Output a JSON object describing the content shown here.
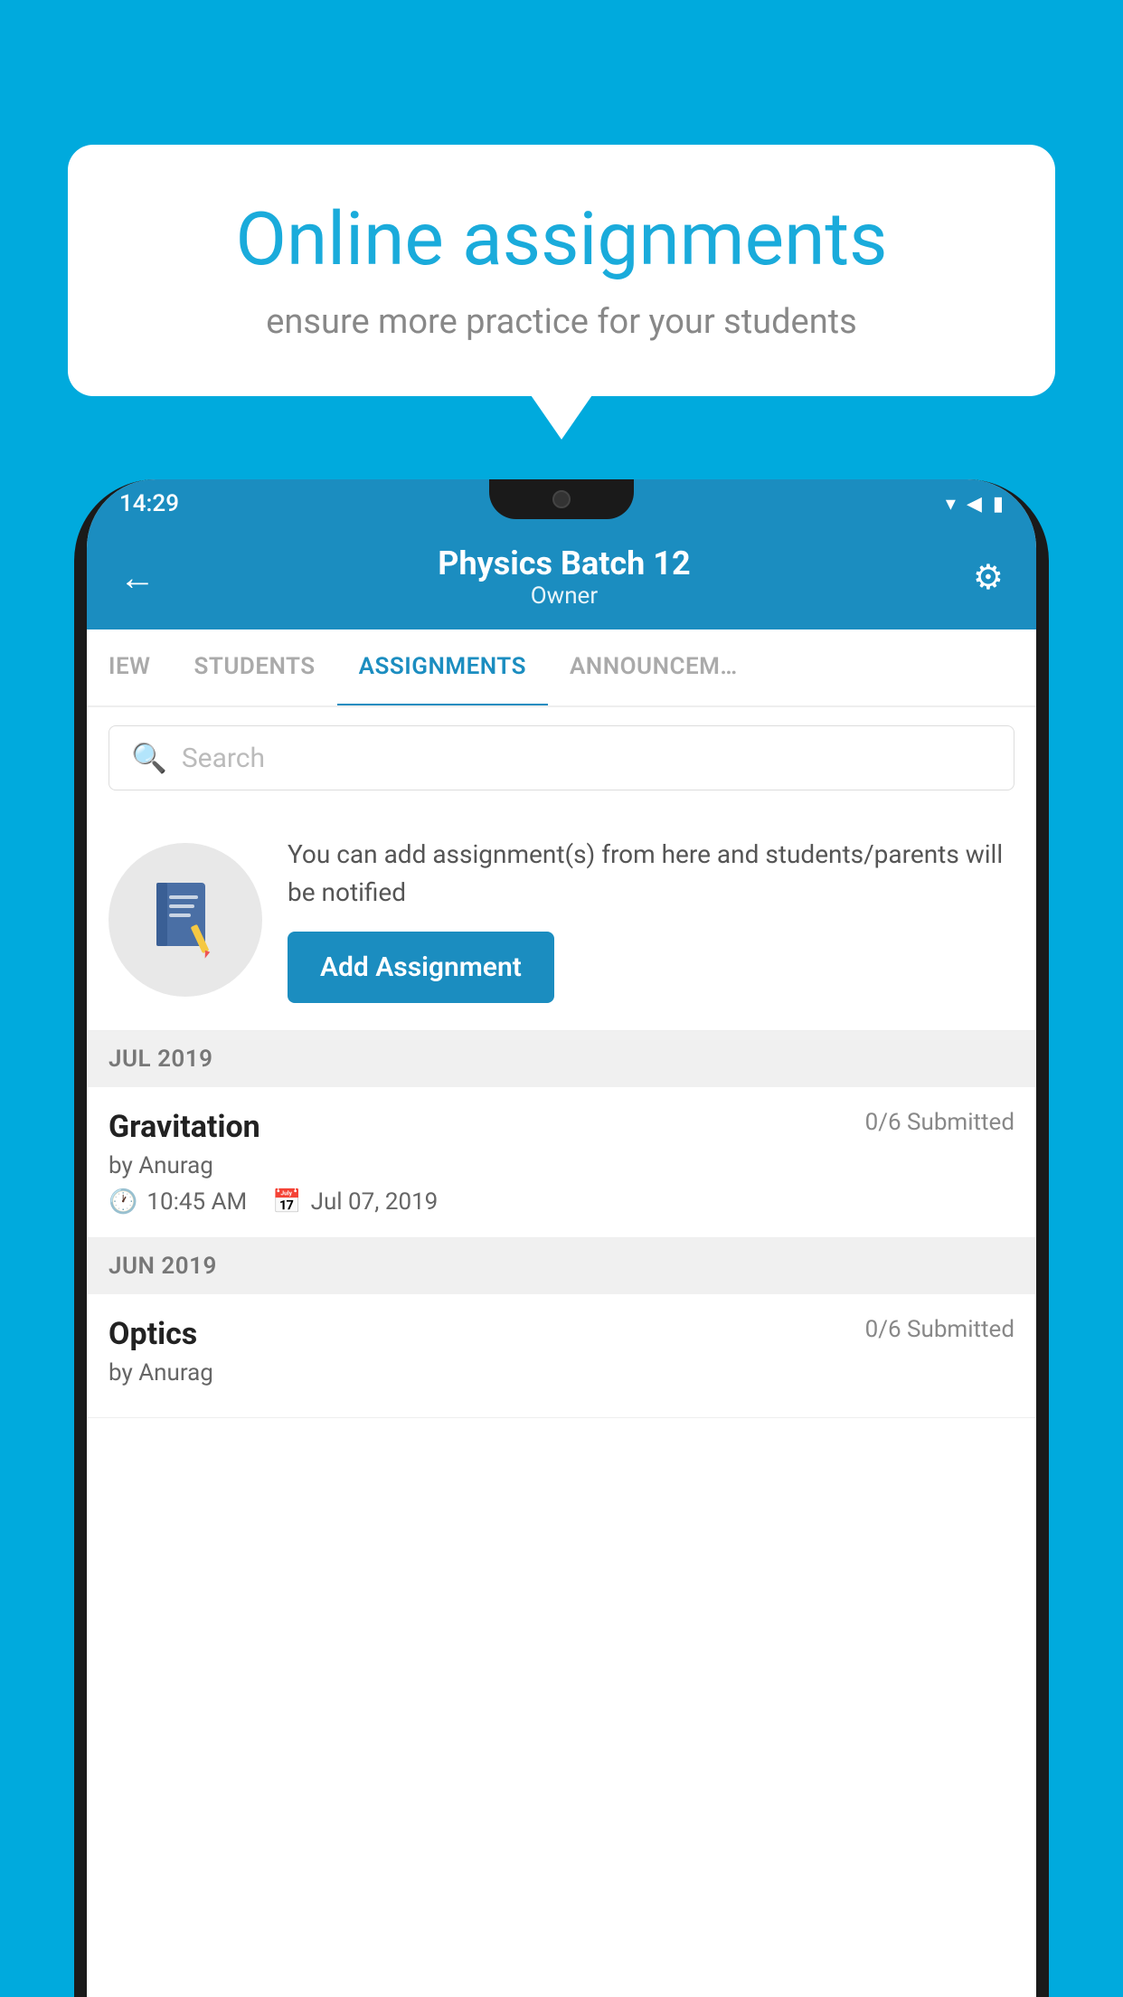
{
  "background": {
    "color": "#00AADD"
  },
  "speechBubble": {
    "title": "Online assignments",
    "subtitle": "ensure more practice for your students"
  },
  "statusBar": {
    "time": "14:29",
    "icons": [
      "wifi",
      "signal",
      "battery"
    ]
  },
  "appHeader": {
    "title": "Physics Batch 12",
    "subtitle": "Owner",
    "backLabel": "←",
    "settingsLabel": "⚙"
  },
  "tabs": [
    {
      "label": "IEW",
      "active": false
    },
    {
      "label": "STUDENTS",
      "active": false
    },
    {
      "label": "ASSIGNMENTS",
      "active": true
    },
    {
      "label": "ANNOUNCEM…",
      "active": false
    }
  ],
  "search": {
    "placeholder": "Search"
  },
  "cta": {
    "description": "You can add assignment(s) from here and students/parents will be notified",
    "buttonLabel": "Add Assignment"
  },
  "sections": [
    {
      "header": "JUL 2019",
      "assignments": [
        {
          "name": "Gravitation",
          "submitted": "0/6 Submitted",
          "author": "by Anurag",
          "time": "10:45 AM",
          "date": "Jul 07, 2019"
        }
      ]
    },
    {
      "header": "JUN 2019",
      "assignments": [
        {
          "name": "Optics",
          "submitted": "0/6 Submitted",
          "author": "by Anurag",
          "time": "",
          "date": ""
        }
      ]
    }
  ]
}
